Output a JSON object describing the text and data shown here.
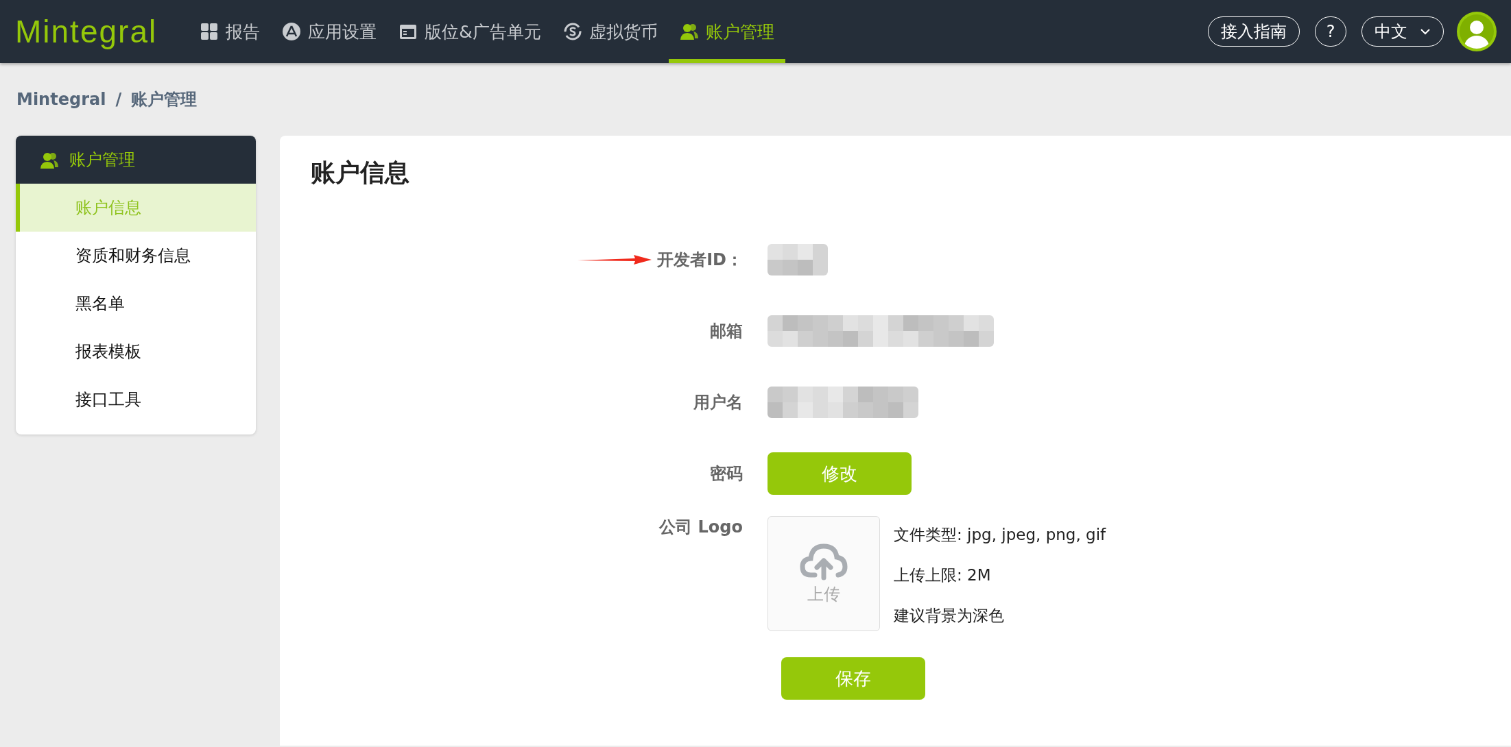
{
  "topbar": {
    "logo": "Mintegral",
    "nav": [
      {
        "label": "报告",
        "selected": false
      },
      {
        "label": "应用设置",
        "selected": false
      },
      {
        "label": "版位&广告单元",
        "selected": false
      },
      {
        "label": "虚拟货币",
        "selected": false
      },
      {
        "label": "账户管理",
        "selected": true
      }
    ],
    "guide": "接入指南",
    "help": "?",
    "language": "中文"
  },
  "breadcrumb": [
    "Mintegral",
    "/",
    "账户管理"
  ],
  "sidebar": {
    "title": "账户管理",
    "items": [
      {
        "label": "账户信息",
        "selected": true
      },
      {
        "label": "资质和财务信息",
        "selected": false
      },
      {
        "label": "黑名单",
        "selected": false
      },
      {
        "label": "报表模板",
        "selected": false
      },
      {
        "label": "接口工具",
        "selected": false
      }
    ]
  },
  "main": {
    "title": "账户信息",
    "fields": [
      {
        "label": "开发者ID：",
        "kind": "redacted",
        "marked": true
      },
      {
        "label": "邮箱",
        "kind": "redacted",
        "marked": false
      },
      {
        "label": "用户名",
        "kind": "redacted",
        "marked": false
      },
      {
        "label": "密码",
        "kind": "button",
        "marked": false,
        "button": "修改"
      },
      {
        "label": "公司 Logo",
        "kind": "upload",
        "marked": false,
        "upload": "上传",
        "hints": [
          "文件类型: jpg, jpeg, png, gif",
          "上传上限: 2M",
          "建议背景为深色"
        ]
      }
    ],
    "save": "保存"
  }
}
